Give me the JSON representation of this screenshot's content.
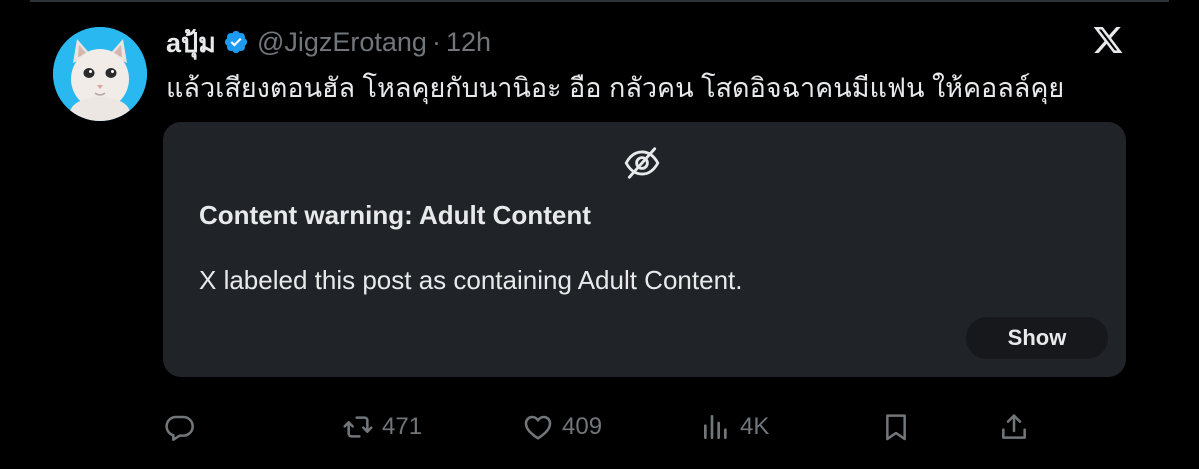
{
  "post": {
    "display_name": "aปุ้ม",
    "handle": "@JigzErotang",
    "separator": "·",
    "time": "12h",
    "text": "แล้วเสียงตอนฮัล โหลคุยกับนานิอะ อือ กลัวคน โสดอิจฉาคนมีแฟน ให้คอลล์คุย"
  },
  "content_warning": {
    "title": "Content warning: Adult Content",
    "description": "X labeled this post as containing Adult Content.",
    "show_label": "Show"
  },
  "actions": {
    "reply_count": "",
    "repost_count": "471",
    "like_count": "409",
    "views_count": "4K"
  },
  "icons": {
    "verified": "verified-badge-icon",
    "brand": "x-logo-icon",
    "hidden": "eye-off-icon",
    "reply": "reply-icon",
    "repost": "repost-icon",
    "like": "heart-icon",
    "views": "views-icon",
    "bookmark": "bookmark-icon",
    "share": "share-icon"
  },
  "colors": {
    "background": "#000000",
    "text": "#e7e9ea",
    "muted": "#71767b",
    "card": "#202327",
    "verified_blue": "#1d9bf0",
    "avatar_bg": "#29b8f0"
  }
}
